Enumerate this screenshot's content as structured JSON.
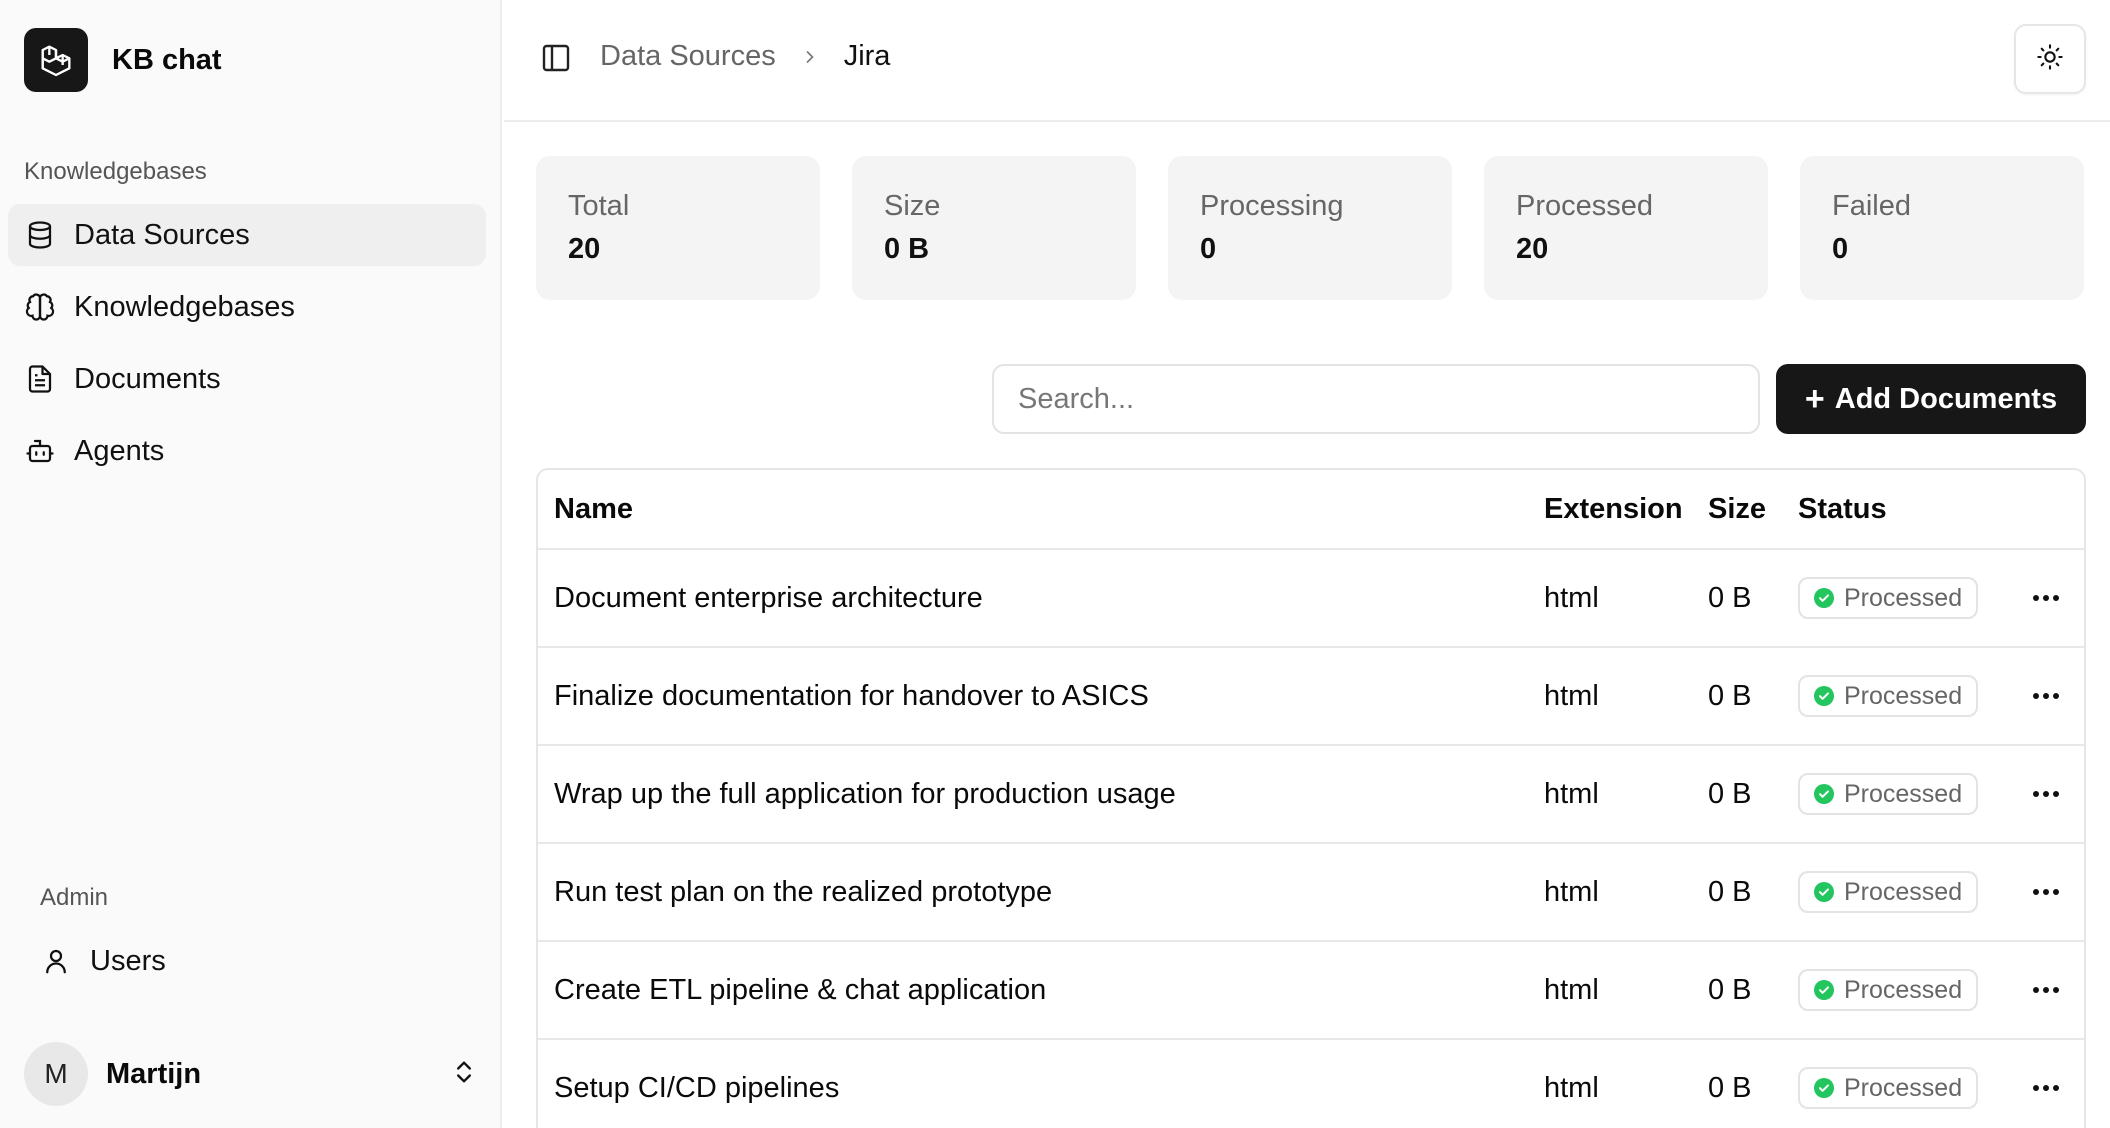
{
  "app": {
    "name": "KB chat"
  },
  "sidebar": {
    "group_label": "Knowledgebases",
    "items": [
      {
        "label": "Data Sources",
        "icon": "database-icon",
        "active": true
      },
      {
        "label": "Knowledgebases",
        "icon": "brain-icon",
        "active": false
      },
      {
        "label": "Documents",
        "icon": "document-icon",
        "active": false
      },
      {
        "label": "Agents",
        "icon": "bot-icon",
        "active": false
      }
    ],
    "admin_label": "Admin",
    "admin_items": [
      {
        "label": "Users",
        "icon": "user-icon"
      }
    ],
    "user": {
      "initial": "M",
      "name": "Martijn"
    }
  },
  "header": {
    "breadcrumb": {
      "parent": "Data Sources",
      "current": "Jira"
    }
  },
  "stats": [
    {
      "label": "Total",
      "value": "20"
    },
    {
      "label": "Size",
      "value": "0 B"
    },
    {
      "label": "Processing",
      "value": "0"
    },
    {
      "label": "Processed",
      "value": "20"
    },
    {
      "label": "Failed",
      "value": "0"
    }
  ],
  "search": {
    "placeholder": "Search..."
  },
  "actions": {
    "add_label": "Add Documents",
    "add_symbol": "+"
  },
  "table": {
    "columns": {
      "name": "Name",
      "extension": "Extension",
      "size": "Size",
      "status": "Status"
    },
    "rows": [
      {
        "name": "Document enterprise architecture",
        "extension": "html",
        "size": "0 B",
        "status": "Processed"
      },
      {
        "name": "Finalize documentation for handover to ASICS",
        "extension": "html",
        "size": "0 B",
        "status": "Processed"
      },
      {
        "name": "Wrap up the full application for production usage",
        "extension": "html",
        "size": "0 B",
        "status": "Processed"
      },
      {
        "name": "Run test plan on the realized prototype",
        "extension": "html",
        "size": "0 B",
        "status": "Processed"
      },
      {
        "name": "Create ETL pipeline & chat application",
        "extension": "html",
        "size": "0 B",
        "status": "Processed"
      },
      {
        "name": "Setup CI/CD pipelines",
        "extension": "html",
        "size": "0 B",
        "status": "Processed"
      }
    ]
  },
  "colors": {
    "accent": "#171717",
    "success": "#22c55e",
    "sidebar_bg": "#fafafa"
  }
}
